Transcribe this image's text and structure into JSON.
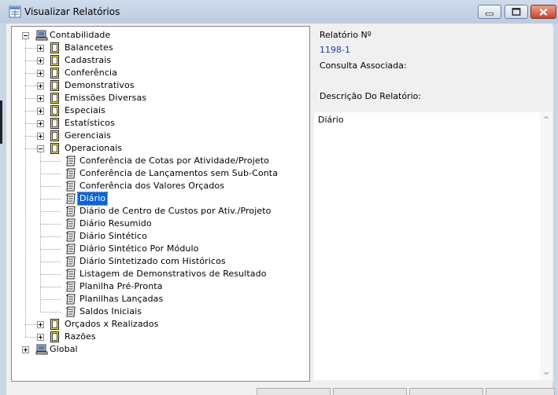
{
  "window": {
    "title": "Visualizar Relatórios",
    "controls": {
      "minimize": "minimize",
      "maximize": "maximize",
      "close": "close"
    }
  },
  "tree": {
    "root": "Contabilidade",
    "categories": [
      {
        "label": "Balancetes",
        "expanded": false
      },
      {
        "label": "Cadastrais",
        "expanded": false
      },
      {
        "label": "Conferência",
        "expanded": false
      },
      {
        "label": "Demonstrativos",
        "expanded": false
      },
      {
        "label": "Emissões Diversas",
        "expanded": false
      },
      {
        "label": "Especiais",
        "expanded": false
      },
      {
        "label": "Estatísticos",
        "expanded": false
      },
      {
        "label": "Gerenciais",
        "expanded": false
      },
      {
        "label": "Operacionais",
        "expanded": true
      },
      {
        "label": "Orçados x Realizados",
        "expanded": false
      },
      {
        "label": "Razões",
        "expanded": false
      }
    ],
    "reports": [
      "Conferência de Cotas por Atividade/Projeto",
      "Conferência de Lançamentos sem Sub-Conta",
      "Conferência dos Valores Orçados",
      "Diário",
      "Diário de Centro de Custos por Ativ./Projeto",
      "Diário Resumido",
      "Diário Sintético",
      "Diário Sintético Por Módulo",
      "Diário Sintetizado com Históricos",
      "Listagem de Demonstrativos de Resultado",
      "Planilha Pré-Pronta",
      "Planilhas Lançadas",
      "Saldos Iniciais"
    ],
    "selected_report": "Diário",
    "second_root": "Global"
  },
  "details": {
    "report_number_label": "Relatório Nº",
    "report_number_value": "1198-1",
    "associated_query_label": "Consulta Associada:",
    "description_label": "Descrição Do Relatório:",
    "description_text": "Diário"
  }
}
